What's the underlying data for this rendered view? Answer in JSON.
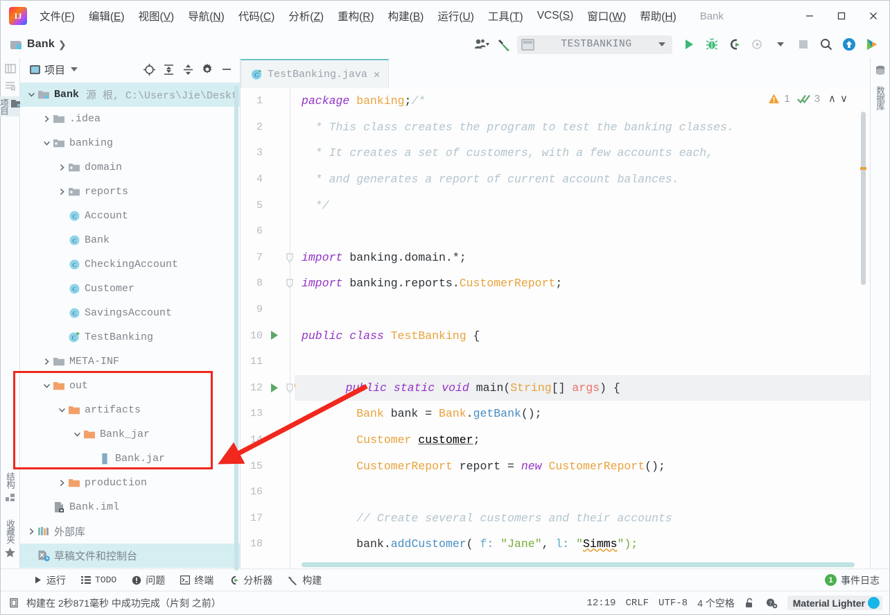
{
  "window": {
    "title": "Bank",
    "minimize_label": "—",
    "maximize_label": "☐",
    "close_label": "✕"
  },
  "menubar": {
    "items": [
      {
        "name": "file",
        "text": "文件",
        "mnemonic": "F"
      },
      {
        "name": "edit",
        "text": "编辑",
        "mnemonic": "E"
      },
      {
        "name": "view",
        "text": "视图",
        "mnemonic": "V"
      },
      {
        "name": "navigate",
        "text": "导航",
        "mnemonic": "N"
      },
      {
        "name": "code",
        "text": "代码",
        "mnemonic": "C"
      },
      {
        "name": "analyze",
        "text": "分析",
        "mnemonic": "Z"
      },
      {
        "name": "refactor",
        "text": "重构",
        "mnemonic": "R"
      },
      {
        "name": "build",
        "text": "构建",
        "mnemonic": "B"
      },
      {
        "name": "run",
        "text": "运行",
        "mnemonic": "U"
      },
      {
        "name": "tools",
        "text": "工具",
        "mnemonic": "T"
      },
      {
        "name": "vcs",
        "text": "VCS",
        "mnemonic": "S"
      },
      {
        "name": "window",
        "text": "窗口",
        "mnemonic": "W"
      },
      {
        "name": "help",
        "text": "帮助",
        "mnemonic": "H"
      }
    ]
  },
  "navbar": {
    "breadcrumb": "Bank",
    "separator": "❯"
  },
  "toolbar": {
    "run_config_name": "TESTBANKING",
    "icons": [
      "user-icon",
      "hammer-build-icon",
      "run-icon",
      "debug-icon",
      "run-with-coverage-icon",
      "profile-icon",
      "stop-icon",
      "search-everywhere-icon",
      "update-project-icon",
      "ide-helper-icon"
    ]
  },
  "left_rail": {
    "items": [
      {
        "name": "project",
        "label": "项目",
        "active": true
      },
      {
        "name": "structure",
        "label": "结构",
        "active": false
      },
      {
        "name": "favorites",
        "label": "收藏夹",
        "active": false
      }
    ]
  },
  "right_rail": {
    "items": [
      {
        "name": "database",
        "label": "数据库"
      }
    ]
  },
  "project_panel": {
    "title": "项目",
    "tree": [
      {
        "indent": 0,
        "arrow": "down",
        "icon": "module-folder-icon",
        "label": "Bank",
        "suffix": "源 根, C:\\Users\\Jie\\Deskt",
        "bold": true,
        "selected": true
      },
      {
        "indent": 1,
        "arrow": "right",
        "icon": "folder-icon",
        "label": ".idea"
      },
      {
        "indent": 1,
        "arrow": "down",
        "icon": "source-folder-icon",
        "label": "banking"
      },
      {
        "indent": 2,
        "arrow": "right",
        "icon": "source-folder-icon",
        "label": "domain"
      },
      {
        "indent": 2,
        "arrow": "right",
        "icon": "source-folder-icon",
        "label": "reports"
      },
      {
        "indent": 2,
        "arrow": "none",
        "icon": "java-class-icon",
        "label": "Account"
      },
      {
        "indent": 2,
        "arrow": "none",
        "icon": "java-class-icon",
        "label": "Bank"
      },
      {
        "indent": 2,
        "arrow": "none",
        "icon": "java-class-icon",
        "label": "CheckingAccount"
      },
      {
        "indent": 2,
        "arrow": "none",
        "icon": "java-class-icon",
        "label": "Customer"
      },
      {
        "indent": 2,
        "arrow": "none",
        "icon": "java-class-icon",
        "label": "SavingsAccount"
      },
      {
        "indent": 2,
        "arrow": "none",
        "icon": "java-runnable-class-icon",
        "label": "TestBanking"
      },
      {
        "indent": 1,
        "arrow": "right",
        "icon": "folder-icon",
        "label": "META-INF"
      },
      {
        "indent": 1,
        "arrow": "down",
        "icon": "orange-folder-icon",
        "label": "out"
      },
      {
        "indent": 2,
        "arrow": "down",
        "icon": "orange-folder-icon",
        "label": "artifacts"
      },
      {
        "indent": 3,
        "arrow": "down",
        "icon": "orange-folder-icon",
        "label": "Bank_jar"
      },
      {
        "indent": 4,
        "arrow": "none",
        "icon": "jar-file-icon",
        "label": "Bank.jar"
      },
      {
        "indent": 2,
        "arrow": "right",
        "icon": "orange-folder-icon",
        "label": "production"
      },
      {
        "indent": 1,
        "arrow": "none",
        "icon": "iml-file-icon",
        "label": "Bank.iml"
      },
      {
        "indent": 0,
        "arrow": "right",
        "icon": "external-libraries-icon",
        "label": "外部库",
        "zh": true
      },
      {
        "indent": 0,
        "arrow": "none",
        "icon": "scratches-icon",
        "label": "草稿文件和控制台",
        "zh": true,
        "selected_bottom": true
      }
    ]
  },
  "editor": {
    "tab": {
      "label": "TestBanking.java",
      "close": "✕",
      "icon": "java-runnable-class-icon"
    },
    "inspections": {
      "warning_icon": "warning-triangle-icon",
      "warning_count": "1",
      "ok_icon": "double-check-icon",
      "ok_count": "3",
      "up": "∧",
      "down": "∨"
    },
    "lines": [
      {
        "n": "1",
        "tokens": [
          {
            "t": "package ",
            "c": "kw"
          },
          {
            "t": "banking",
            "c": "cls"
          },
          {
            "t": ";",
            "c": "plain"
          },
          {
            "t": "/*",
            "c": "cmt"
          }
        ]
      },
      {
        "n": "2",
        "tokens": [
          {
            "t": "  * This class creates the program to test the banking classes.",
            "c": "cmt"
          }
        ]
      },
      {
        "n": "3",
        "tokens": [
          {
            "t": "  * It creates a set of customers, with a few accounts each,",
            "c": "cmt"
          }
        ]
      },
      {
        "n": "4",
        "tokens": [
          {
            "t": "  * and generates a report of current account balances.",
            "c": "cmt"
          }
        ]
      },
      {
        "n": "5",
        "tokens": [
          {
            "t": "  */",
            "c": "cmt"
          }
        ]
      },
      {
        "n": "6",
        "tokens": []
      },
      {
        "n": "7",
        "tokens": [
          {
            "t": "import ",
            "c": "kw"
          },
          {
            "t": "banking.domain.*",
            "c": "plain"
          },
          {
            "t": ";",
            "c": "plain"
          }
        ],
        "fold": true
      },
      {
        "n": "8",
        "tokens": [
          {
            "t": "import ",
            "c": "kw"
          },
          {
            "t": "banking.reports.",
            "c": "plain"
          },
          {
            "t": "CustomerReport",
            "c": "cls"
          },
          {
            "t": ";",
            "c": "plain"
          }
        ],
        "fold": true
      },
      {
        "n": "9",
        "tokens": []
      },
      {
        "n": "10",
        "tokens": [
          {
            "t": "public class ",
            "c": "kw"
          },
          {
            "t": "TestBanking",
            "c": "cls"
          },
          {
            "t": " {",
            "c": "plain"
          }
        ],
        "run_marker": true
      },
      {
        "n": "11",
        "tokens": []
      },
      {
        "n": "12",
        "tokens": [
          {
            "t": "    public static void ",
            "c": "kw"
          },
          {
            "t": "main",
            "c": "plain"
          },
          {
            "t": "(",
            "c": "plain"
          },
          {
            "t": "String",
            "c": "cls"
          },
          {
            "t": "[] ",
            "c": "plain"
          },
          {
            "t": "args",
            "c": "param"
          },
          {
            "t": ") {",
            "c": "plain"
          }
        ],
        "run_marker": true,
        "bulb": true,
        "fold": true,
        "highlight": true
      },
      {
        "n": "13",
        "tokens": [
          {
            "t": "        ",
            "c": "plain"
          },
          {
            "t": "Bank",
            "c": "cls"
          },
          {
            "t": " bank = ",
            "c": "plain"
          },
          {
            "t": "Bank",
            "c": "cls"
          },
          {
            "t": ".",
            "c": "plain"
          },
          {
            "t": "getBank",
            "c": "meth"
          },
          {
            "t": "();",
            "c": "plain"
          }
        ]
      },
      {
        "n": "14",
        "tokens": [
          {
            "t": "        ",
            "c": "plain"
          },
          {
            "t": "Customer",
            "c": "cls"
          },
          {
            "t": " ",
            "c": "plain"
          },
          {
            "t": "customer",
            "c": "underl"
          },
          {
            "t": ";",
            "c": "plain"
          }
        ]
      },
      {
        "n": "15",
        "tokens": [
          {
            "t": "        ",
            "c": "plain"
          },
          {
            "t": "CustomerReport",
            "c": "cls"
          },
          {
            "t": " report = ",
            "c": "plain"
          },
          {
            "t": "new ",
            "c": "kw"
          },
          {
            "t": "CustomerReport",
            "c": "cls"
          },
          {
            "t": "();",
            "c": "plain"
          }
        ]
      },
      {
        "n": "16",
        "tokens": []
      },
      {
        "n": "17",
        "tokens": [
          {
            "t": "        // Create several customers and their accounts",
            "c": "cmt"
          }
        ]
      },
      {
        "n": "18",
        "tokens": [
          {
            "t": "        bank.",
            "c": "plain"
          },
          {
            "t": "addCustomer",
            "c": "meth"
          },
          {
            "t": "( ",
            "c": "plain"
          },
          {
            "t": "f:",
            "c": "hintp"
          },
          {
            "t": " \"Jane\"",
            "c": "str"
          },
          {
            "t": ", ",
            "c": "plain"
          },
          {
            "t": "l:",
            "c": "hintp"
          },
          {
            "t": " \"",
            "c": "str"
          },
          {
            "t": "Simms",
            "c": "wavy"
          },
          {
            "t": "\");",
            "c": "str"
          }
        ]
      }
    ]
  },
  "tool_window_bar": {
    "items": [
      {
        "name": "run",
        "icon": "run-icon",
        "label": "运行"
      },
      {
        "name": "todo",
        "icon": "todo-icon",
        "label": "TODO"
      },
      {
        "name": "problems",
        "icon": "problems-icon",
        "label": "问题"
      },
      {
        "name": "terminal",
        "icon": "terminal-icon",
        "label": "终端"
      },
      {
        "name": "profiler",
        "icon": "profiler-icon",
        "label": "分析器"
      },
      {
        "name": "build",
        "icon": "hammer-build-icon",
        "label": "构建"
      }
    ],
    "event_log": {
      "count": "1",
      "label": "事件日志"
    }
  },
  "statusbar": {
    "message": "构建在 2秒871毫秒 中成功完成（片刻 之前）",
    "caret_position": "12:19",
    "line_separator": "CRLF",
    "encoding": "UTF-8",
    "indent": "4 个空格",
    "lock_icon": "unlocked-padlock-icon",
    "inspection_icon": "inspection-level-icon",
    "theme": "Material Lighter"
  },
  "annotation": {
    "box_color": "#f0281e",
    "arrow_color": "#f0281e"
  }
}
